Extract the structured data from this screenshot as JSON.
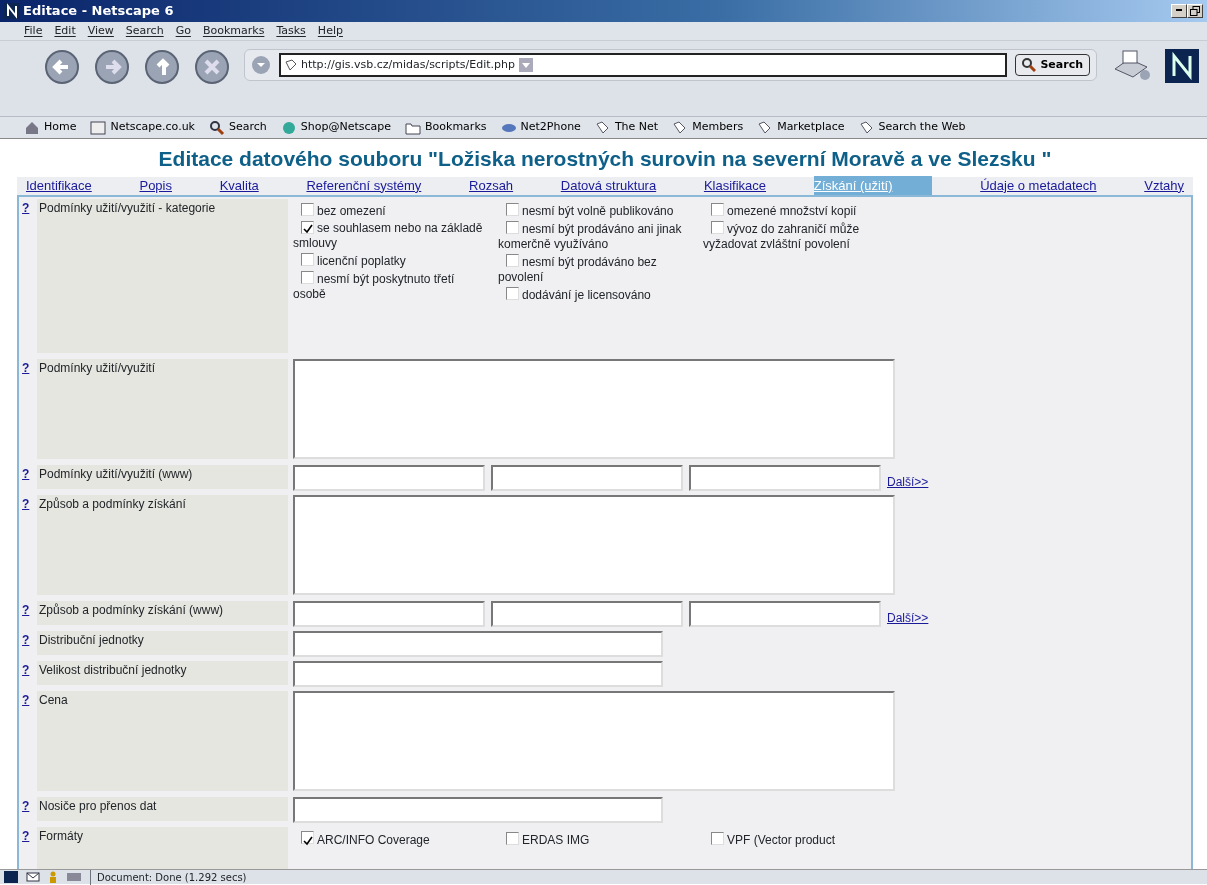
{
  "window": {
    "title": "Editace - Netscape 6"
  },
  "menu": [
    "File",
    "Edit",
    "View",
    "Search",
    "Go",
    "Bookmarks",
    "Tasks",
    "Help"
  ],
  "navigation": {
    "url": "http://gis.vsb.cz/midas/scripts/Edit.php",
    "search_button": "Search"
  },
  "personal_toolbar": [
    {
      "label": "Home",
      "kind": "home"
    },
    {
      "label": "Netscape.co.uk",
      "kind": "my"
    },
    {
      "label": "Search",
      "kind": "search"
    },
    {
      "label": "Shop@Netscape",
      "kind": "shop"
    },
    {
      "label": "Bookmarks",
      "kind": "folder"
    },
    {
      "label": "Net2Phone",
      "kind": "phone"
    },
    {
      "label": "The Net",
      "kind": "bookmark"
    },
    {
      "label": "Members",
      "kind": "bookmark"
    },
    {
      "label": "Marketplace",
      "kind": "bookmark"
    },
    {
      "label": "Search the Web",
      "kind": "bookmark"
    }
  ],
  "page": {
    "heading": "Editace datového souboru \"Ložiska nerostných surovin na severní Moravě a ve Slezsku \"",
    "tabs": [
      {
        "label": "Identifikace",
        "selected": false
      },
      {
        "label": "Popis",
        "selected": false
      },
      {
        "label": "Kvalita",
        "selected": false
      },
      {
        "label": "Referenční systémy",
        "selected": false
      },
      {
        "label": "Rozsah",
        "selected": false
      },
      {
        "label": "Datová struktura",
        "selected": false
      },
      {
        "label": "Klasifikace",
        "selected": false
      },
      {
        "label": "Získání (užití)",
        "selected": true
      },
      {
        "label": "Údaje o metadatech",
        "selected": false
      },
      {
        "label": "Vztahy",
        "selected": false
      }
    ],
    "form": [
      {
        "help": "?",
        "label": "Podmínky užití/využití - kategorie",
        "kind": "checkgroup",
        "columns": [
          [
            {
              "label": "bez omezení",
              "checked": false
            },
            {
              "label": "se souhlasem nebo na základě smlouvy",
              "checked": true
            },
            {
              "label": "licenční poplatky",
              "checked": false
            },
            {
              "label": "nesmí být poskytnuto třetí osobě",
              "checked": false
            }
          ],
          [
            {
              "label": "nesmí být volně publikováno",
              "checked": false
            },
            {
              "label": "nesmí být prodáváno ani jinak komerčně využíváno",
              "checked": false
            },
            {
              "label": "nesmí být prodáváno bez povolení",
              "checked": false
            },
            {
              "label": "dodávání je licensováno",
              "checked": false
            }
          ],
          [
            {
              "label": "omezené množství kopií",
              "checked": false
            },
            {
              "label": "vývoz do zahraničí může vyžadovat zvláštní povolení",
              "checked": false
            }
          ]
        ]
      },
      {
        "help": "?",
        "label": "Podmínky užití/využití",
        "kind": "textarea"
      },
      {
        "help": "?",
        "label": "Podmínky užití/využití (www)",
        "kind": "urls",
        "inputs": [
          {
            "kind": "text"
          },
          {
            "kind": "text"
          },
          {
            "kind": "text"
          }
        ],
        "more": "Další>>"
      },
      {
        "help": "?",
        "label": "Způsob a podmínky získání",
        "kind": "textarea"
      },
      {
        "help": "?",
        "label": "Způsob a podmínky získání (www)",
        "kind": "urls",
        "inputs": [
          {
            "kind": "text"
          },
          {
            "kind": "text"
          },
          {
            "kind": "text"
          }
        ],
        "more": "Další>>"
      },
      {
        "help": "?",
        "label": "Distribuční jednotky",
        "kind": "input"
      },
      {
        "help": "?",
        "label": "Velikost distribuční jednotky",
        "kind": "input"
      },
      {
        "help": "?",
        "label": "Cena",
        "kind": "textarea"
      },
      {
        "help": "?",
        "label": "Nosiče pro přenos dat",
        "kind": "input"
      },
      {
        "help": "?",
        "label": "Formáty",
        "kind": "formats",
        "options": [
          {
            "label": "ARC/INFO Coverage",
            "checked": true
          },
          {
            "label": "ERDAS IMG",
            "checked": false
          },
          {
            "label": "VPF (Vector product",
            "checked": false
          }
        ]
      }
    ]
  },
  "status_bar": {
    "text": "Document: Done (1.292 secs)"
  }
}
